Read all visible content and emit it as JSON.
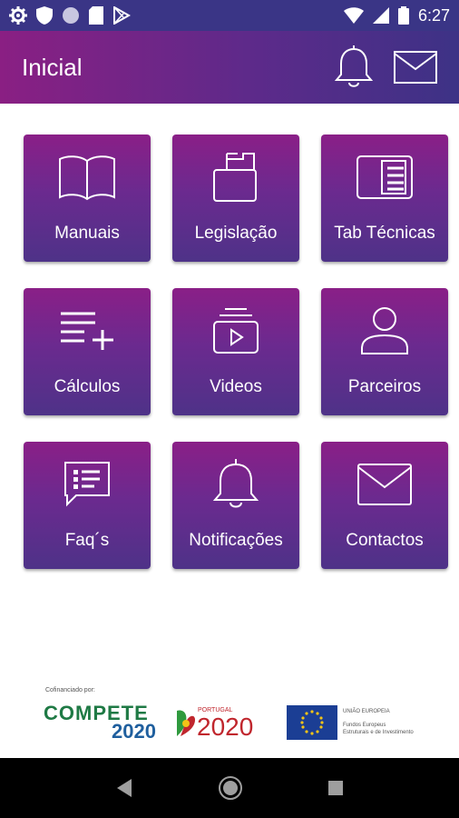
{
  "status_bar": {
    "time": "6:27",
    "left_icons": [
      "gear-icon",
      "shield-icon",
      "circle-icon",
      "sd-card-icon",
      "play-store-icon"
    ],
    "right_icons": [
      "wifi-icon",
      "signal-icon",
      "battery-icon"
    ]
  },
  "app_bar": {
    "title": "Inicial",
    "actions": [
      "bell-icon",
      "envelope-icon"
    ]
  },
  "tiles": [
    {
      "label": "Manuais",
      "icon": "book-icon"
    },
    {
      "label": "Legislação",
      "icon": "document-stack-icon"
    },
    {
      "label": "Tab Técnicas",
      "icon": "table-doc-icon"
    },
    {
      "label": "Cálculos",
      "icon": "list-plus-icon"
    },
    {
      "label": "Videos",
      "icon": "video-play-icon"
    },
    {
      "label": "Parceiros",
      "icon": "person-icon"
    },
    {
      "label": "Faq´s",
      "icon": "chat-list-icon"
    },
    {
      "label": "Notificações",
      "icon": "bell-icon"
    },
    {
      "label": "Contactos",
      "icon": "envelope-icon"
    }
  ],
  "footer": {
    "cofinanced": "Cofinanciado por:",
    "compete_word": "COMPETE",
    "compete_year": "2020",
    "portugal_small": "PORTUGAL",
    "portugal_big": "2020",
    "eu_title": "UNIÃO EUROPEIA",
    "eu_line1": "Fundos Europeus",
    "eu_line2": "Estruturais e de Investimento"
  },
  "colors": {
    "primary_purple": "#8a1f83",
    "primary_indigo": "#3d3286",
    "status_bar": "#3a3586"
  },
  "nav_bar": [
    "back-icon",
    "home-icon",
    "recents-icon"
  ]
}
